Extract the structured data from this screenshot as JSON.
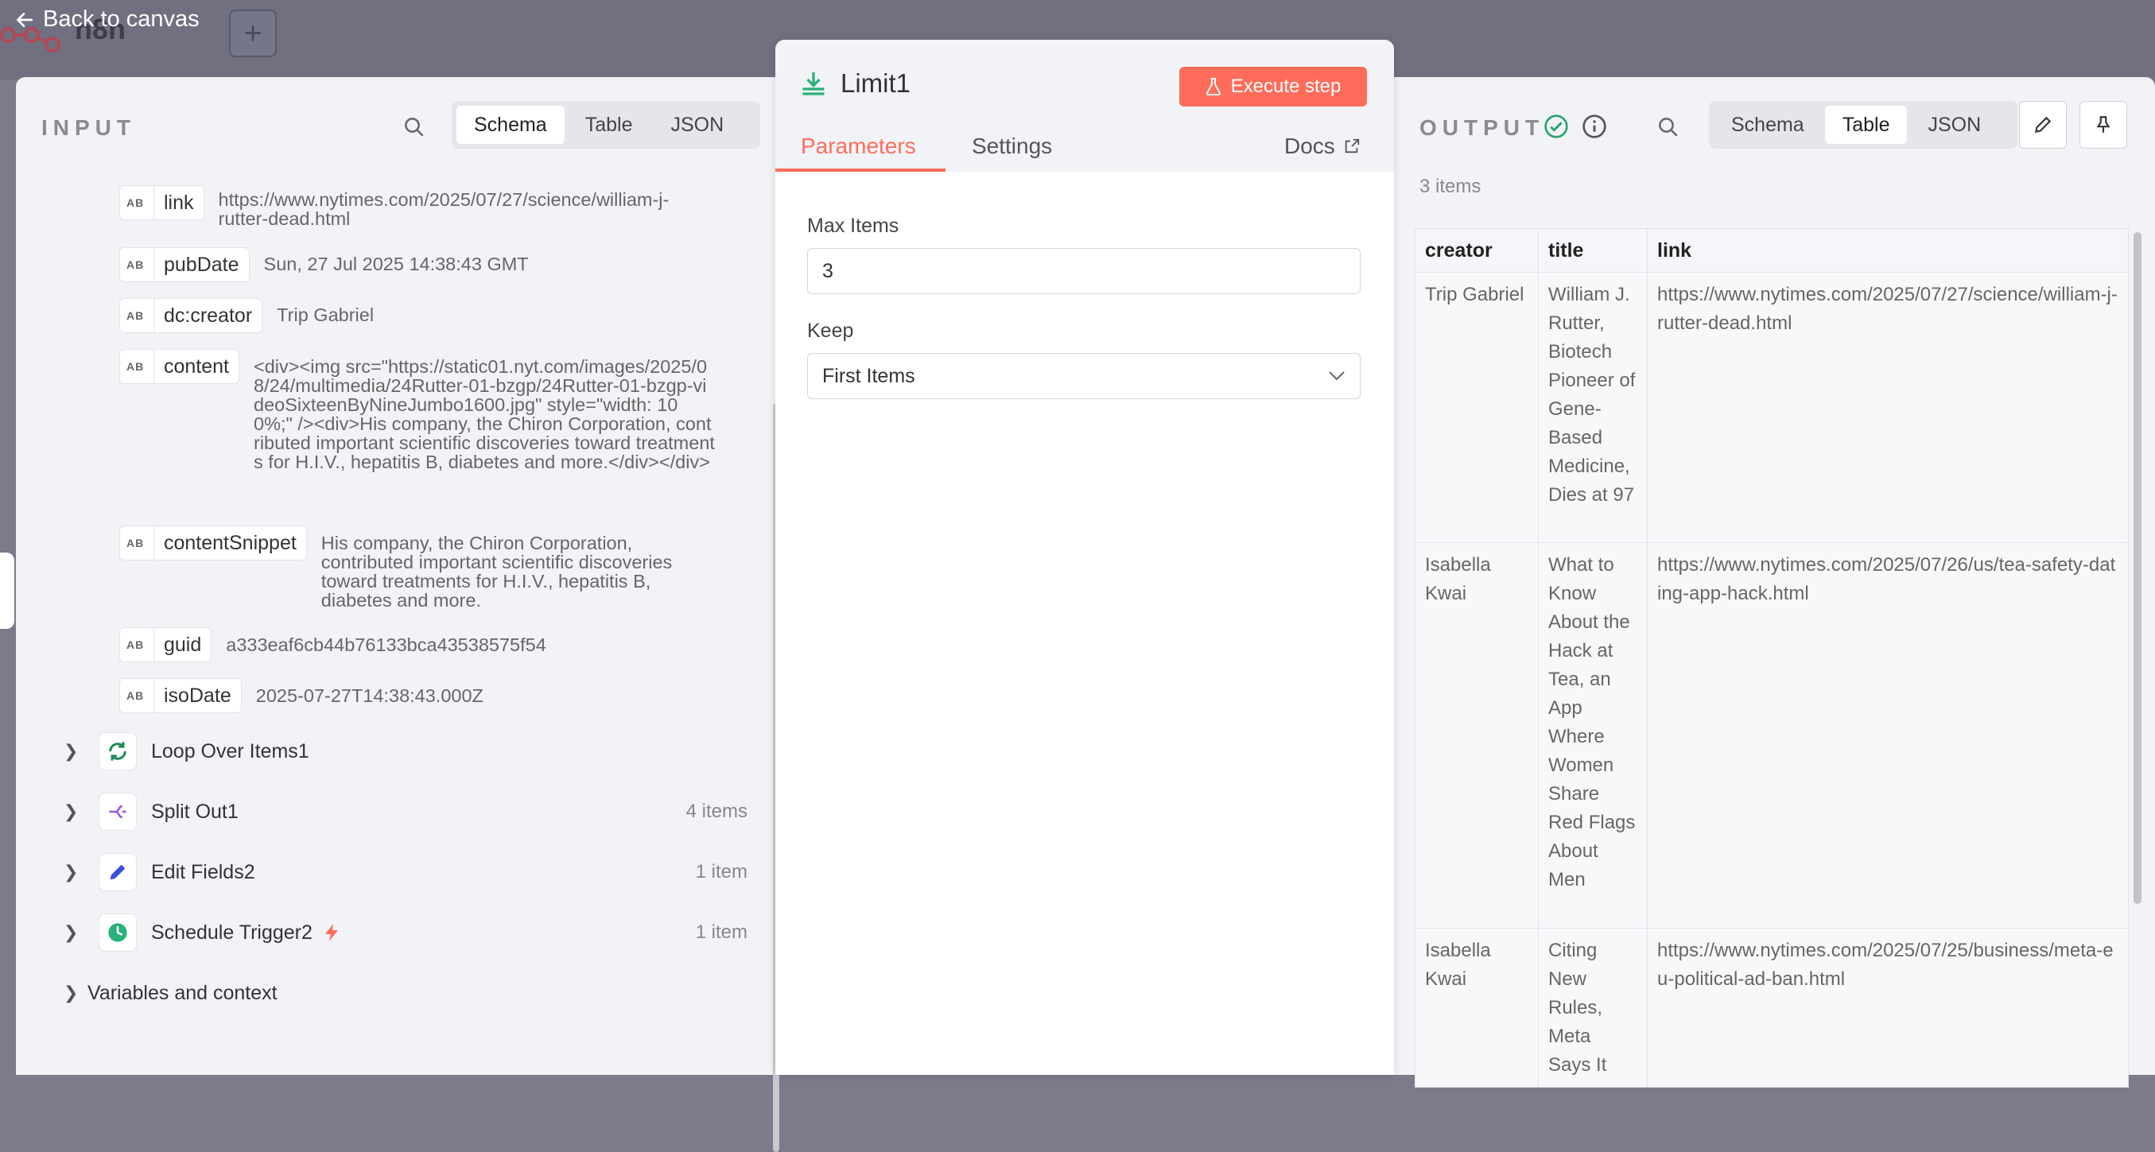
{
  "canvas": {
    "back_label": "Back to canvas",
    "logo_text": "n8n",
    "plus_label": "+"
  },
  "input": {
    "title": "INPUT",
    "view_tabs": [
      "Schema",
      "Table",
      "JSON"
    ],
    "active_tab": "Schema",
    "badge": "AB",
    "fields": [
      {
        "key": "link",
        "value": "https://www.nytimes.com/2025/07/27/science/william-j-rutter-dead.html"
      },
      {
        "key": "pubDate",
        "value": "Sun, 27 Jul 2025 14:38:43 GMT"
      },
      {
        "key": "dc:creator",
        "value": "Trip Gabriel"
      },
      {
        "key": "content",
        "value": "<div><img src=\"https://static01.nyt.com/images/2025/08/24/multimedia/24Rutter-01-bzgp/24Rutter-01-bzgp-videoSixteenByNineJumbo1600.jpg\" style=\"width: 100%;\" /><div>His company, the Chiron Corporation, contributed important scientific discoveries toward treatments for H.I.V., hepatitis B, diabetes and more.</div></div>"
      },
      {
        "key": "contentSnippet",
        "value": "His company, the Chiron Corporation, contributed important scientific discoveries toward treatments for H.I.V., hepatitis B, diabetes and more."
      },
      {
        "key": "guid",
        "value": "a333eaf6cb44b76133bca43538575f54"
      },
      {
        "key": "isoDate",
        "value": "2025-07-27T14:38:43.000Z"
      }
    ],
    "nodes": [
      {
        "label": "Loop Over Items1",
        "count": "",
        "icon": "loop-icon"
      },
      {
        "label": "Split Out1",
        "count": "4 items",
        "icon": "split-icon"
      },
      {
        "label": "Edit Fields2",
        "count": "1 item",
        "icon": "pencil-icon"
      },
      {
        "label": "Schedule Trigger2",
        "count": "1 item",
        "icon": "clock-icon"
      }
    ],
    "variables_label": "Variables and context"
  },
  "main": {
    "node_name": "Limit1",
    "execute_label": "Execute step",
    "tabs": {
      "parameters": "Parameters",
      "settings": "Settings",
      "docs": "Docs"
    },
    "max_items_label": "Max Items",
    "max_items_value": "3",
    "keep_label": "Keep",
    "keep_value": "First Items"
  },
  "output": {
    "title": "OUTPUT",
    "view_tabs": [
      "Schema",
      "Table",
      "JSON"
    ],
    "active_tab": "Table",
    "items_count": "3 items",
    "columns": [
      "creator",
      "title",
      "link"
    ],
    "rows": [
      [
        "Trip Gabriel",
        "William J. Rutter, Biotech Pioneer of Gene-Based Medicine, Dies at 97",
        "https://www.nytimes.com/2025/07/27/science/william-j-rutter-dead.html"
      ],
      [
        "Isabella Kwai",
        "What to Know About the Hack at Tea, an App Where Women Share Red Flags About Men",
        "https://www.nytimes.com/2025/07/26/us/tea-safety-dating-app-hack.html"
      ],
      [
        "Isabella Kwai",
        "Citing New Rules, Meta Says It",
        "https://www.nytimes.com/2025/07/25/business/meta-eu-political-ad-ban.html"
      ]
    ]
  },
  "colors": {
    "accent": "#ff6d5a",
    "success": "#29a36a",
    "panel_bg": "#f1f3f7"
  }
}
